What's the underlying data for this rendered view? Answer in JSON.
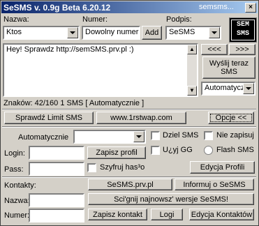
{
  "title": {
    "app": "SeSMS v. 0.9g Beta    6.20.12",
    "right": "semsms..."
  },
  "labels": {
    "nazwa": "Nazwa:",
    "numer": "Numer:",
    "podpis": "Podpis:",
    "login": "Login:",
    "pass": "Pass:",
    "kontakty": "Kontakty:",
    "nazwa2": "Nazwa:",
    "numer2": "Numer:",
    "automatycznie": "Automatycznie"
  },
  "fields": {
    "nazwa": "Ktos",
    "numer": "Dowolny numer",
    "podpis": "SeSMS",
    "message": "Hey! Sprawdz http://semSMS.prv.pl :)",
    "auto_select": "Automatycz"
  },
  "buttons": {
    "add": "Add",
    "prev": "<<<",
    "next": ">>>",
    "send": "Wyślij teraz SMS",
    "sprawdz": "Sprawdź Limit SMS",
    "site": "www.1rstwap.com",
    "opcje": "Opcje <<",
    "zapisz_profil": "Zapisz profil",
    "edycja_profili": "Edycja Profili",
    "sesms_prv": "SeSMS.prv.pl",
    "informuj": "Informuj o SeSMS",
    "sciagnij": "Sci'gnij najnowsz' wersje SeSMS!",
    "zapisz_kontakt": "Zapisz kontakt",
    "logi": "Logi",
    "edycja_kontaktow": "Edycja Kontaktów"
  },
  "status": {
    "znakow": "Znaków: 42/160  1 SMS   [ Automatycznie ]"
  },
  "options": {
    "dziel": "Dziel SMS",
    "nie_zapisuj": "Nie zapisuj",
    "uzyj_gg": "U¿yj GG",
    "flash": "Flash SMS",
    "szyfruj": "Szyfruj has³o"
  },
  "logo": "SEM SMS"
}
